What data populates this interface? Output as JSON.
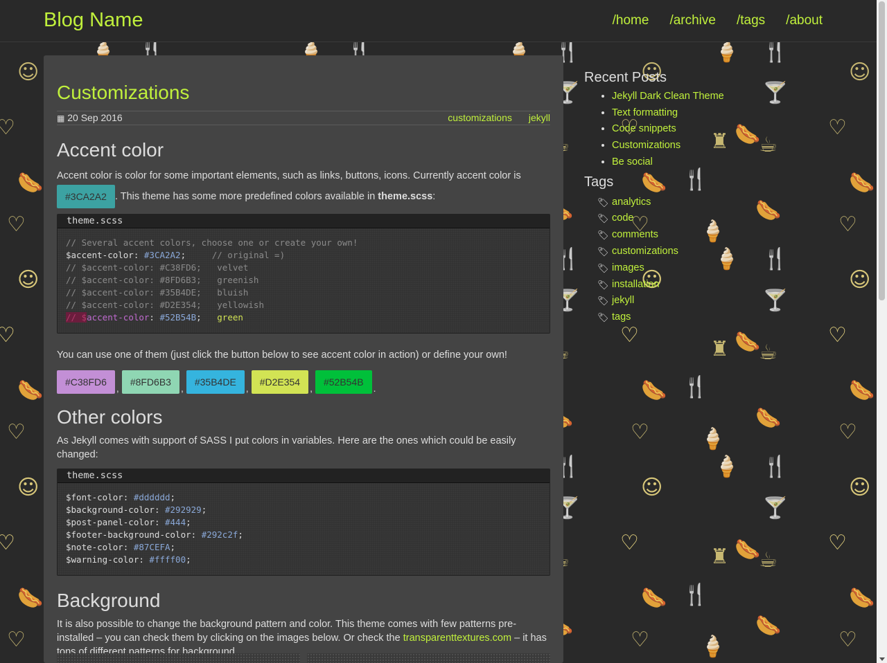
{
  "header": {
    "blog_name": "Blog Name",
    "nav": [
      "/home",
      "/archive",
      "/tags",
      "/about"
    ]
  },
  "post": {
    "title": "Customizations",
    "date": "20 Sep 2016",
    "tags": [
      "customizations",
      "jekyll"
    ],
    "accent": {
      "heading": "Accent color",
      "intro_1": "Accent color is color for some important elements, such as links, buttons, icons. Currently accent color is",
      "current": "#3CA2A2",
      "intro_2": ". This theme has some more predefined colors available in",
      "intro_file": "theme.scss",
      "intro_3": ":",
      "code_file": "theme.scss",
      "code_lines": [
        "// Several accent colors, choose one or create your own!",
        "$accent-color: #3CA2A2;     // original =)",
        "// $accent-color: #C38FD6;   velvet",
        "// $accent-color: #8FD6B3;   greenish",
        "// $accent-color: #35B4DE;   bluish",
        "// $accent-color: #D2E354;   yellowish",
        "// $accent-color: #52B54B;   green"
      ],
      "after_text": "You can use one of them (just click the button below to see accent color in action) or define your own!",
      "swatches": [
        {
          "label": "#C38FD6",
          "color": "#C38FD6"
        },
        {
          "label": "#8FD6B3",
          "color": "#8FD6B3"
        },
        {
          "label": "#35B4DE",
          "color": "#35B4DE"
        },
        {
          "label": "#D2E354",
          "color": "#D2E354"
        },
        {
          "label": "#52B54B",
          "color": "#00c03a"
        }
      ]
    },
    "other": {
      "heading": "Other colors",
      "intro": "As Jekyll comes with support of SASS I put colors in variables. Here are the ones which could be easily changed:",
      "code_file": "theme.scss",
      "vars": [
        {
          "name": "$font-color",
          "value": "#dddddd"
        },
        {
          "name": "$background-color",
          "value": "#292929"
        },
        {
          "name": "$post-panel-color",
          "value": "#444"
        },
        {
          "name": "$footer-background-color",
          "value": "#292c2f"
        },
        {
          "name": "$note-color",
          "value": "#87CEFA"
        },
        {
          "name": "$warning-color",
          "value": "#ffff00"
        }
      ]
    },
    "background": {
      "heading": "Background",
      "text_1": "It is also possible to change the background pattern and color. This theme comes with few patterns pre-installed – you can check them by clicking on the images below. Or check the",
      "link": "transparenttextures.com",
      "text_2": "– it has tons of different patterns for background."
    }
  },
  "sidebar": {
    "recent_title": "Recent Posts",
    "recent": [
      "Jekyll Dark Clean Theme",
      "Text formatting",
      "Code snippets",
      "Customizations",
      "Be social"
    ],
    "tags_title": "Tags",
    "tags": [
      "analytics",
      "code",
      "comments",
      "customizations",
      "images",
      "installation",
      "jekyll",
      "tags"
    ]
  },
  "colors": {
    "accent": "#c0f03c",
    "current_accent": "#3CA2A2"
  }
}
